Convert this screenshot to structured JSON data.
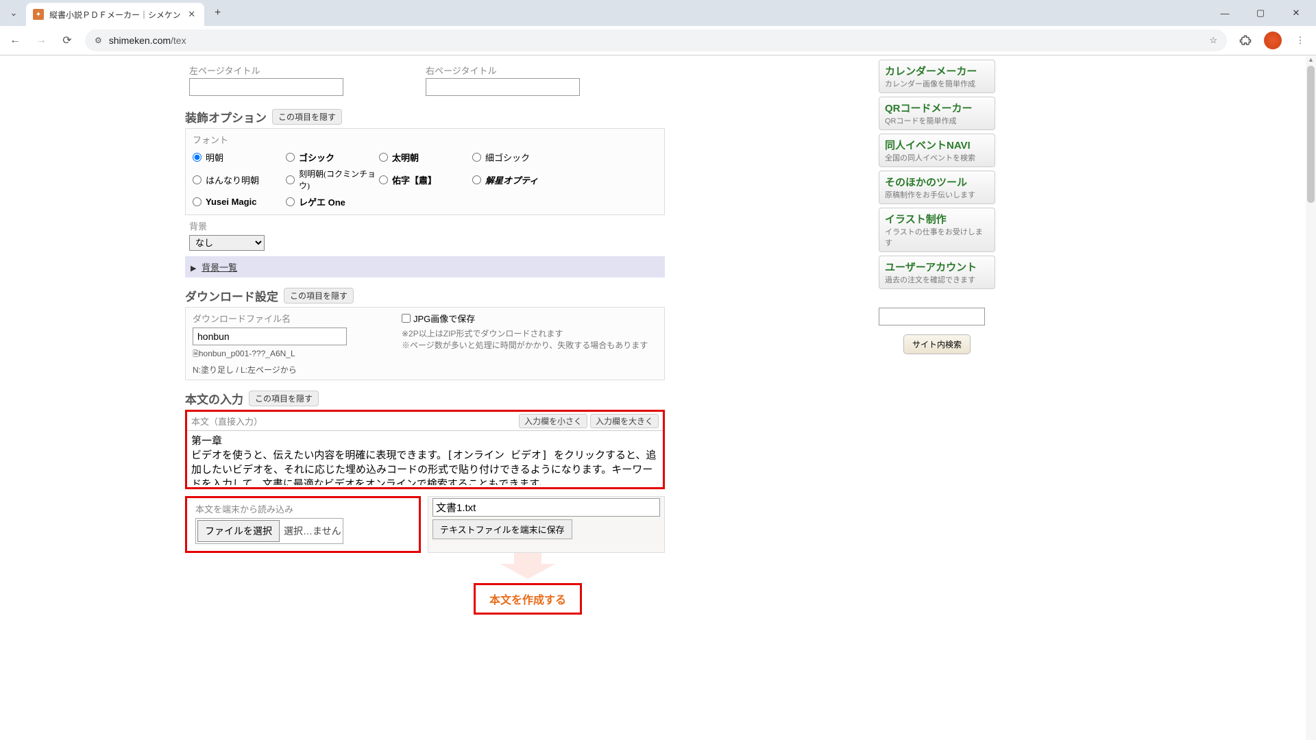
{
  "browser": {
    "tab_title": "縦書小説ＰＤＦメーカー｜シメケン",
    "url_domain": "shimeken.com",
    "url_path": "/tex",
    "minimize": "—",
    "maximize": "▢",
    "close": "✕"
  },
  "form": {
    "left_page_title_label": "左ページタイトル",
    "right_page_title_label": "右ページタイトル",
    "left_page_title_value": "",
    "right_page_title_value": ""
  },
  "decoration": {
    "section": "装飾オプション",
    "hide": "この項目を隠す",
    "font_label": "フォント",
    "fonts": [
      "明朝",
      "ゴシック",
      "太明朝",
      "細ゴシック",
      "はんなり明朝",
      "刻明朝(コクミンチョウ)",
      "佑字【肅】",
      "解星オプティ",
      "Yusei Magic",
      "レゲエ One"
    ],
    "font_selected": "明朝",
    "bg_label": "背景",
    "bg_value": "なし",
    "bg_list": "背景一覧"
  },
  "download": {
    "section": "ダウンロード設定",
    "hide": "この項目を隠す",
    "filename_label": "ダウンロードファイル名",
    "filename_value": "honbun",
    "filename_pattern": "honbun_p001-???_A6N_L",
    "filename_note": "N:塗り足し / L:左ページから",
    "jpg_label": "JPG画像で保存",
    "jpg_note1": "※2P以上はZIP形式でダウンロードされます",
    "jpg_note2": "※ページ数が多いと処理に時間がかかり、失敗する場合もあります"
  },
  "body": {
    "section": "本文の入力",
    "hide": "この項目を隠す",
    "direct_label": "本文（直接入力）",
    "btn_smaller": "入力欄を小さく",
    "btn_larger": "入力欄を大きく",
    "textarea_value": "第一章\nビデオを使うと、伝えたい内容を明確に表現できます。[オンライン ビデオ] をクリックすると、追加したいビデオを、それに応じた埋め込みコードの形式で貼り付けできるようになります。キーワードを入力して、文書に最適なビデオをオンラインで検索することもできます。\nWord に用意されているヘッダー、フッター、表紙、テキスト ボックス デザインを組み合わせる",
    "load_label": "本文を端末から読み込み",
    "choose_file": "ファイルを選択",
    "no_file": "選択…ません",
    "save_filename": "文書1.txt",
    "save_btn": "テキストファイルを端末に保存",
    "generate": "本文を作成する"
  },
  "sidebar": {
    "items": [
      {
        "title": "カレンダーメーカー",
        "desc": "カレンダー画像を簡単作成"
      },
      {
        "title": "QRコードメーカー",
        "desc": "QRコードを簡単作成"
      },
      {
        "title": "同人イベントNAVI",
        "desc": "全国の同人イベントを検索"
      },
      {
        "title": "そのほかのツール",
        "desc": "原稿制作をお手伝いします"
      },
      {
        "title": "イラスト制作",
        "desc": "イラストの仕事をお受けします"
      },
      {
        "title": "ユーザーアカウント",
        "desc": "過去の注文を確認できます"
      }
    ],
    "search_btn": "サイト内検索"
  }
}
